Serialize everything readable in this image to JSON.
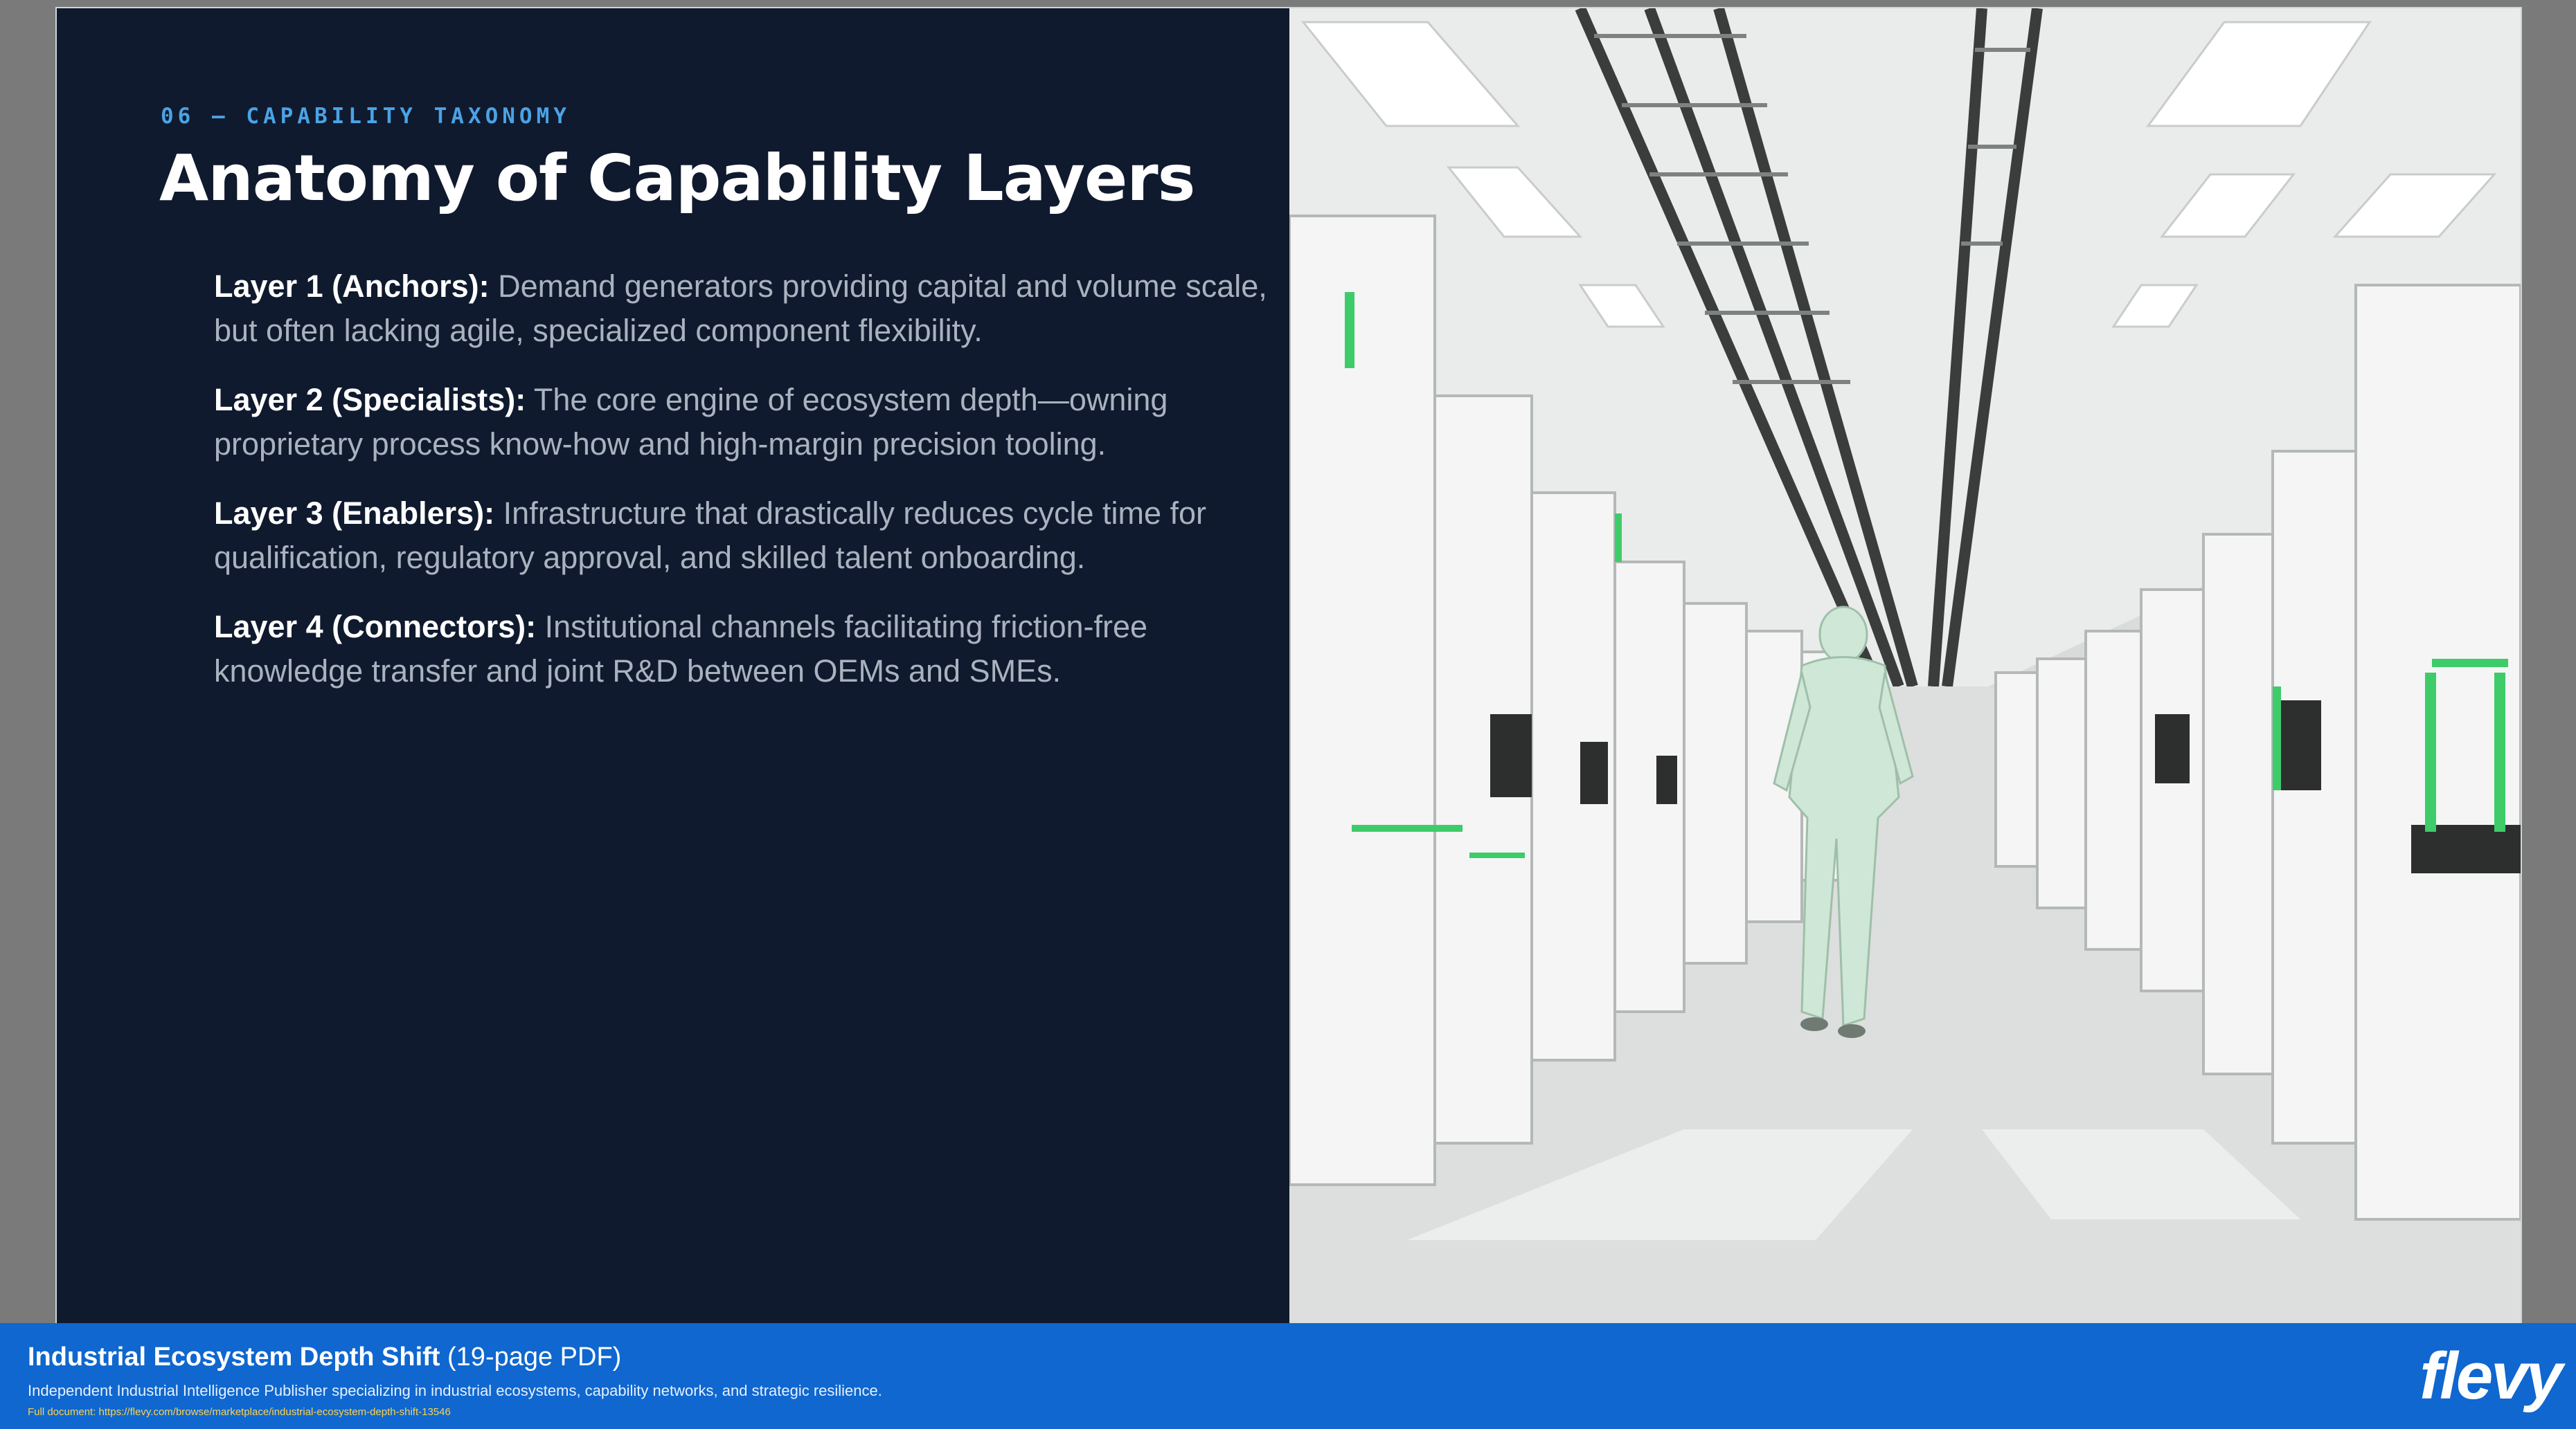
{
  "slide": {
    "eyebrow": "06 — CAPABILITY TAXONOMY",
    "title": "Anatomy of Capability Layers",
    "layers": [
      {
        "name": "Layer 1 (Anchors):",
        "text": " Demand generators providing capital and volume scale, but often lacking agile, specialized component flexibility."
      },
      {
        "name": "Layer 2 (Specialists):",
        "text": " The core engine of ecosystem depth—owning proprietary process know-how and high-margin precision tooling."
      },
      {
        "name": "Layer 3 (Enablers):",
        "text": " Infrastructure that drastically reduces cycle time for qualification, regulatory approval, and skilled talent onboarding."
      },
      {
        "name": "Layer 4 (Connectors):",
        "text": " Institutional channels facilitating friction-free knowledge transfer and joint R&D between OEMs and SMEs."
      }
    ],
    "photo_icon": "cleanroom-photo"
  },
  "footer": {
    "title": "Industrial Ecosystem Depth Shift",
    "title_suffix": "(19-page PDF)",
    "description": "Independent Industrial Intelligence Publisher specializing in industrial ecosystems, capability networks, and strategic resilience.",
    "url": "Full document: https://flevy.com/browse/marketplace/industrial-ecosystem-depth-shift-13546",
    "logo": "flevy"
  },
  "colors": {
    "slide_bg": "#101a2e",
    "accent": "#4aa3e6",
    "footer_bg": "#0f67cf",
    "photo_green": "#3ecb6a"
  }
}
